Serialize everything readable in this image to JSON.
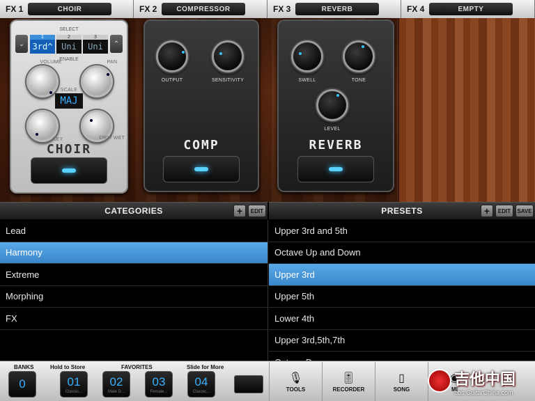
{
  "fx_slots": [
    {
      "num": "FX 1",
      "name": "CHOIR"
    },
    {
      "num": "FX 2",
      "name": "COMPRESSOR"
    },
    {
      "num": "FX 3",
      "name": "REVERB"
    },
    {
      "num": "FX 4",
      "name": "EMPTY"
    }
  ],
  "choir_pedal": {
    "select_label": "SELECT",
    "enable_label": "ENABLE",
    "voices": [
      {
        "num": "1",
        "value": "3rd^"
      },
      {
        "num": "2",
        "value": "Uni"
      },
      {
        "num": "3",
        "value": "Uni"
      }
    ],
    "knobs": {
      "volume": "VOLUME",
      "pan": "PAN",
      "key": "KEY",
      "drywet": "DRY/ WET"
    },
    "scale_label": "SCALE",
    "scale_value": "MAJ",
    "title": "CHOIR"
  },
  "comp_pedal": {
    "knob1": "OUTPUT",
    "knob2": "SENSITIVITY",
    "title": "COMP"
  },
  "reverb_pedal": {
    "knob1": "SWELL",
    "knob2": "TONE",
    "knob3": "LEVEL",
    "title": "REVERB"
  },
  "categories": {
    "title": "CATEGORIES",
    "add": "+",
    "edit": "EDIT",
    "items": [
      "Lead",
      "Harmony",
      "Extreme",
      "Morphing",
      "FX"
    ],
    "selected": "Harmony"
  },
  "presets": {
    "title": "PRESETS",
    "add": "+",
    "edit": "EDIT",
    "save": "SAVE",
    "items": [
      "Upper 3rd and 5th",
      "Octave Up and Down",
      "Upper 3rd",
      "Upper 5th",
      "Lower 4th",
      "Upper 3rd,5th,7th",
      "Octave Down"
    ],
    "selected": "Upper 3rd"
  },
  "bottom": {
    "banks_label": "BANKS",
    "hold_label": "Hold to Store",
    "favorites_label": "FAVORITES",
    "slide_label": "Slide for More",
    "bank_value": "0",
    "favorites": [
      {
        "num": "01",
        "sub": "Classic..."
      },
      {
        "num": "02",
        "sub": "Male D..."
      },
      {
        "num": "03",
        "sub": "Female..."
      },
      {
        "num": "04",
        "sub": "Classic..."
      }
    ],
    "tools": [
      {
        "label": "TOOLS",
        "icon": "microphone-icon"
      },
      {
        "label": "RECORDER",
        "icon": "mixer-sliders-icon"
      },
      {
        "label": "SONG",
        "icon": "ipod-icon"
      },
      {
        "label": "MI",
        "icon": "midi-icon"
      }
    ]
  },
  "watermark": {
    "cn": "吉他中国",
    "url": "bbs.GuitarChina.com"
  }
}
